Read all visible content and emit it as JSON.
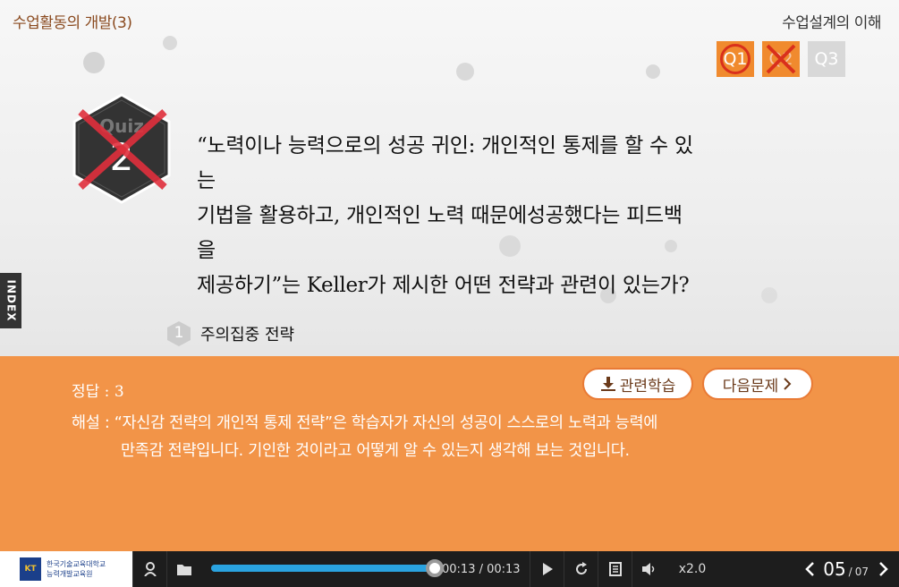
{
  "header": {
    "left_title": "수업활동의 개발(3)",
    "right_title": "수업설계의 이해"
  },
  "question_badges": [
    {
      "label": "Q1",
      "state": "answered"
    },
    {
      "label": "Q2",
      "state": "wrong"
    },
    {
      "label": "Q3",
      "state": "pending"
    }
  ],
  "quiz_badge": {
    "word": "Quiz",
    "number": "2",
    "result": "incorrect"
  },
  "question": {
    "lines": [
      "“노력이나 능력으로의 성공 귀인: 개인적인 통제를 할 수 있",
      "는",
      "기법을 활용하고, 개인적인 노력 때문에성공했다는 피드백",
      "을",
      "제공하기”는 Keller가 제시한 어떤 전략과 관련이 있는가?"
    ]
  },
  "option": {
    "number": "1",
    "text": "주의집중 전략"
  },
  "side_tab": {
    "label": "INDEX"
  },
  "answer": {
    "label": "정답 : 3",
    "related_button": "관련학습",
    "next_button": "다음문제",
    "explanation_line1": "해설 : “자신감 전략의 개인적 통제 전략”은 학습자가 자신의 성공이 스스로의 노력과 능력에",
    "explanation_line2": "만족감 전략입니다. 기인한 것이라고 어떻게 알 수 있는지 생각해 보는 것입니다."
  },
  "player": {
    "logo_line1": "한국기술교육대학교",
    "logo_line2": "능력개발교육원",
    "logo_mark": "KOREATECH",
    "time": "00:13 / 00:13",
    "progress_fraction": 1.0,
    "speed": "x2.0",
    "page_current": "05",
    "page_total": "07"
  },
  "colors": {
    "accent": "#f29448",
    "wrong": "#d9301c",
    "progress": "#2aa3e0"
  }
}
